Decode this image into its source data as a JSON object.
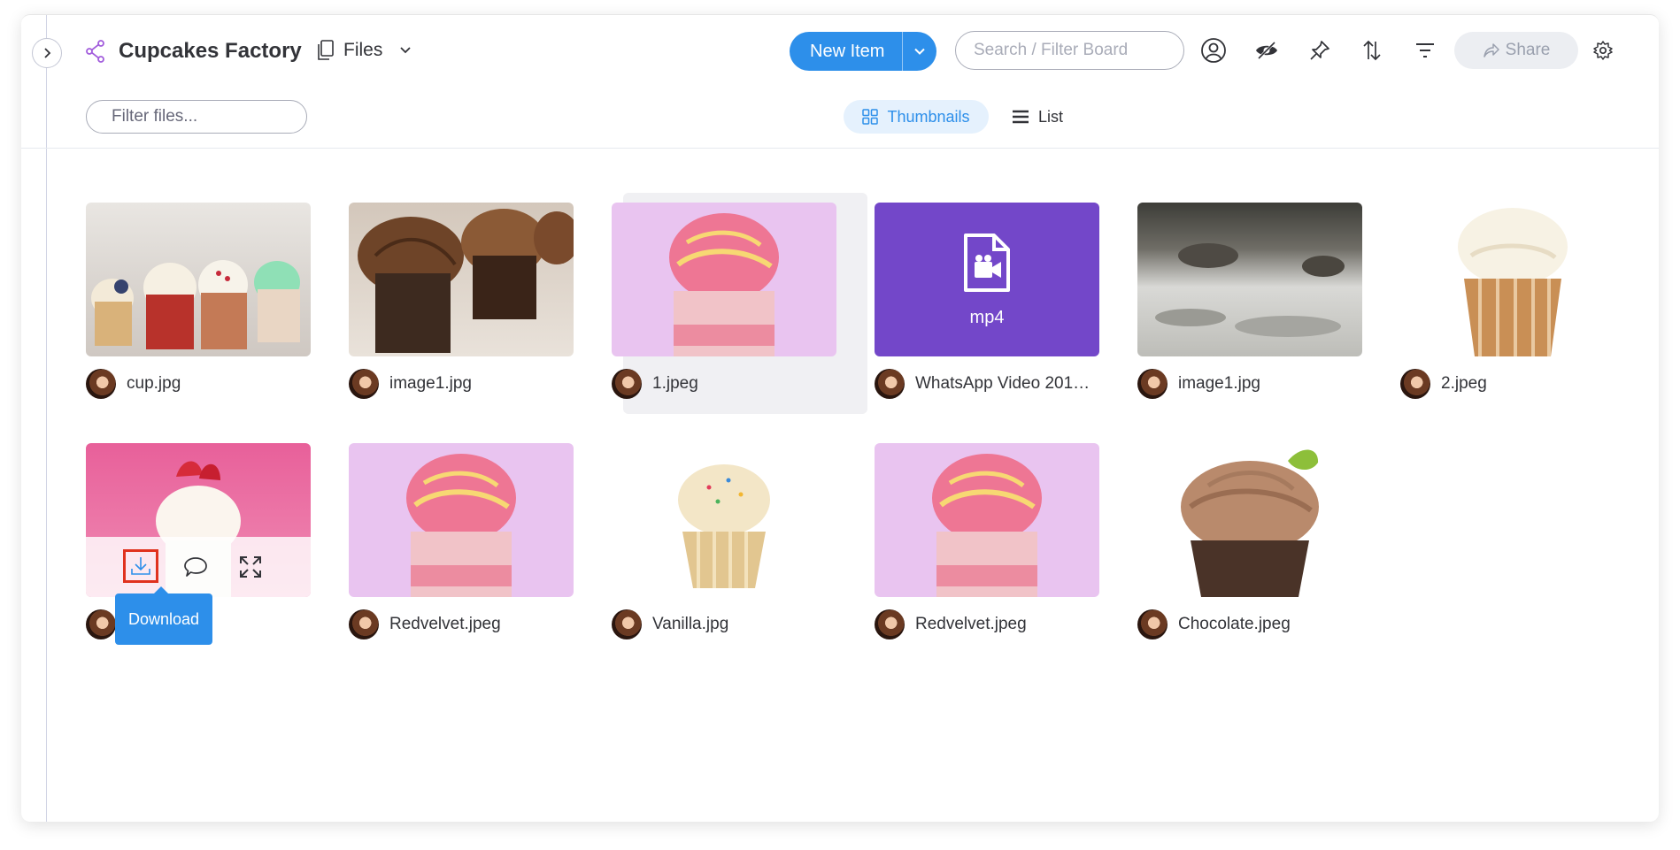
{
  "header": {
    "board_name": "Cupcakes Factory",
    "view_name": "Files",
    "new_item_label": "New Item",
    "search_placeholder": "Search / Filter Board",
    "share_label": "Share"
  },
  "filter_bar": {
    "filter_placeholder": "Filter files...",
    "thumbnails_label": "Thumbnails",
    "list_label": "List"
  },
  "tooltip": {
    "label": "Download"
  },
  "colors": {
    "accent": "#2d8fea",
    "video_tile": "#7347c9",
    "highlight_border": "#e0321e"
  },
  "files": [
    {
      "name": "cup.jpg"
    },
    {
      "name": "image1.jpg"
    },
    {
      "name": "1.jpeg"
    },
    {
      "name": "WhatsApp Video 201…",
      "type_label": "mp4"
    },
    {
      "name": "image1.jpg"
    },
    {
      "name": "2.jpeg"
    },
    {
      "name": ""
    },
    {
      "name": "Redvelvet.jpeg"
    },
    {
      "name": "Vanilla.jpg"
    },
    {
      "name": "Redvelvet.jpeg"
    },
    {
      "name": "Chocolate.jpeg"
    }
  ]
}
